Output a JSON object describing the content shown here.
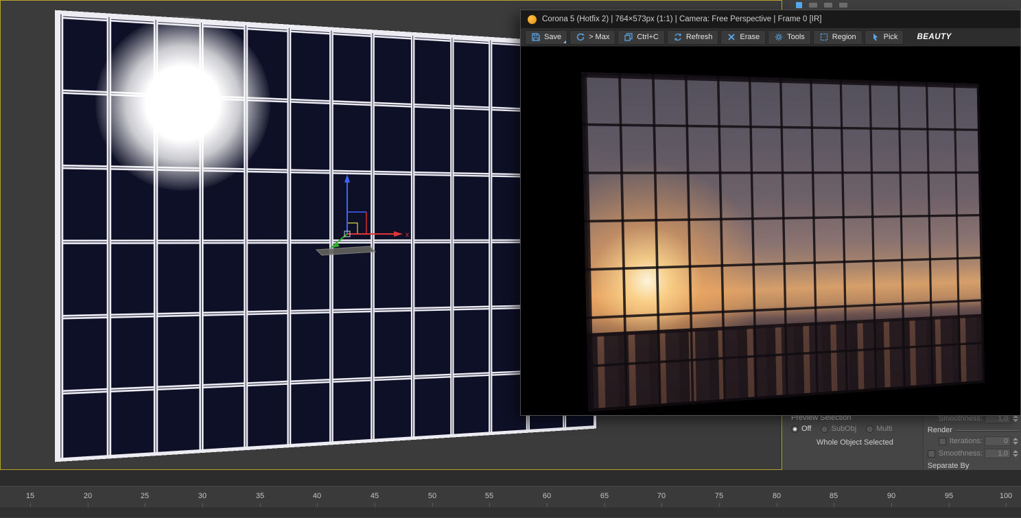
{
  "corona_window": {
    "title": "Corona 5 (Hotfix 2) | 764×573px (1:1) | Camera: Free Perspective | Frame 0 [IR]",
    "toolbar": {
      "buttons": [
        {
          "label": "Save",
          "icon": "save-icon"
        },
        {
          "label": "> Max",
          "icon": "send-to-max-icon"
        },
        {
          "label": "Ctrl+C",
          "icon": "copy-icon"
        },
        {
          "label": "Refresh",
          "icon": "refresh-icon"
        },
        {
          "label": "Erase",
          "icon": "erase-icon"
        },
        {
          "label": "Tools",
          "icon": "tools-icon"
        },
        {
          "label": "Region",
          "icon": "region-icon"
        },
        {
          "label": "Pick",
          "icon": "pick-icon"
        }
      ],
      "channel": "BEAUTY"
    }
  },
  "command_panel": {
    "preview_selection": {
      "header": "Preview Selection",
      "options": [
        {
          "label": "Off",
          "selected": true
        },
        {
          "label": "SubObj",
          "selected": false
        },
        {
          "label": "Multi",
          "selected": false
        }
      ],
      "status": "Whole Object Selected"
    },
    "render_rollout": {
      "smoothness_top_label": "Smoothness:",
      "smoothness_top_value": "1,0",
      "group_label": "Render",
      "iterations_label": "Iterations:",
      "iterations_value": "0",
      "smoothness_label": "Smoothness:",
      "smoothness_value": "1,0",
      "separate_by_label": "Separate By"
    }
  },
  "gizmo": {
    "axis_x_label": "x"
  },
  "timeline": {
    "ticks": [
      "15",
      "20",
      "25",
      "30",
      "35",
      "40",
      "45",
      "50",
      "55",
      "60",
      "65",
      "70",
      "75",
      "80",
      "85",
      "90",
      "95",
      "100"
    ]
  },
  "colors": {
    "accent_blue": "#58aaf0",
    "corona_orange": "#f08a00",
    "active_viewport_border": "#b5a42b",
    "wall_panel_navy": "#0e1027"
  }
}
